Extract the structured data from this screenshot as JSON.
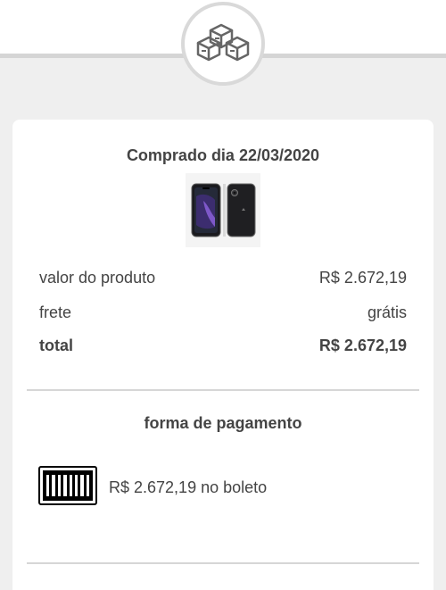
{
  "header": {
    "icon": "boxes-icon"
  },
  "purchase": {
    "title": "Comprado dia 22/03/2020",
    "product_image": "phone-product-image"
  },
  "summary": {
    "product_label": "valor do produto",
    "product_value": "R$ 2.672,19",
    "shipping_label": "frete",
    "shipping_value": "grátis",
    "total_label": "total",
    "total_value": "R$ 2.672,19"
  },
  "payment": {
    "title": "forma de pagamento",
    "method_icon": "barcode-icon",
    "method_text": "R$ 2.672,19 no boleto"
  }
}
